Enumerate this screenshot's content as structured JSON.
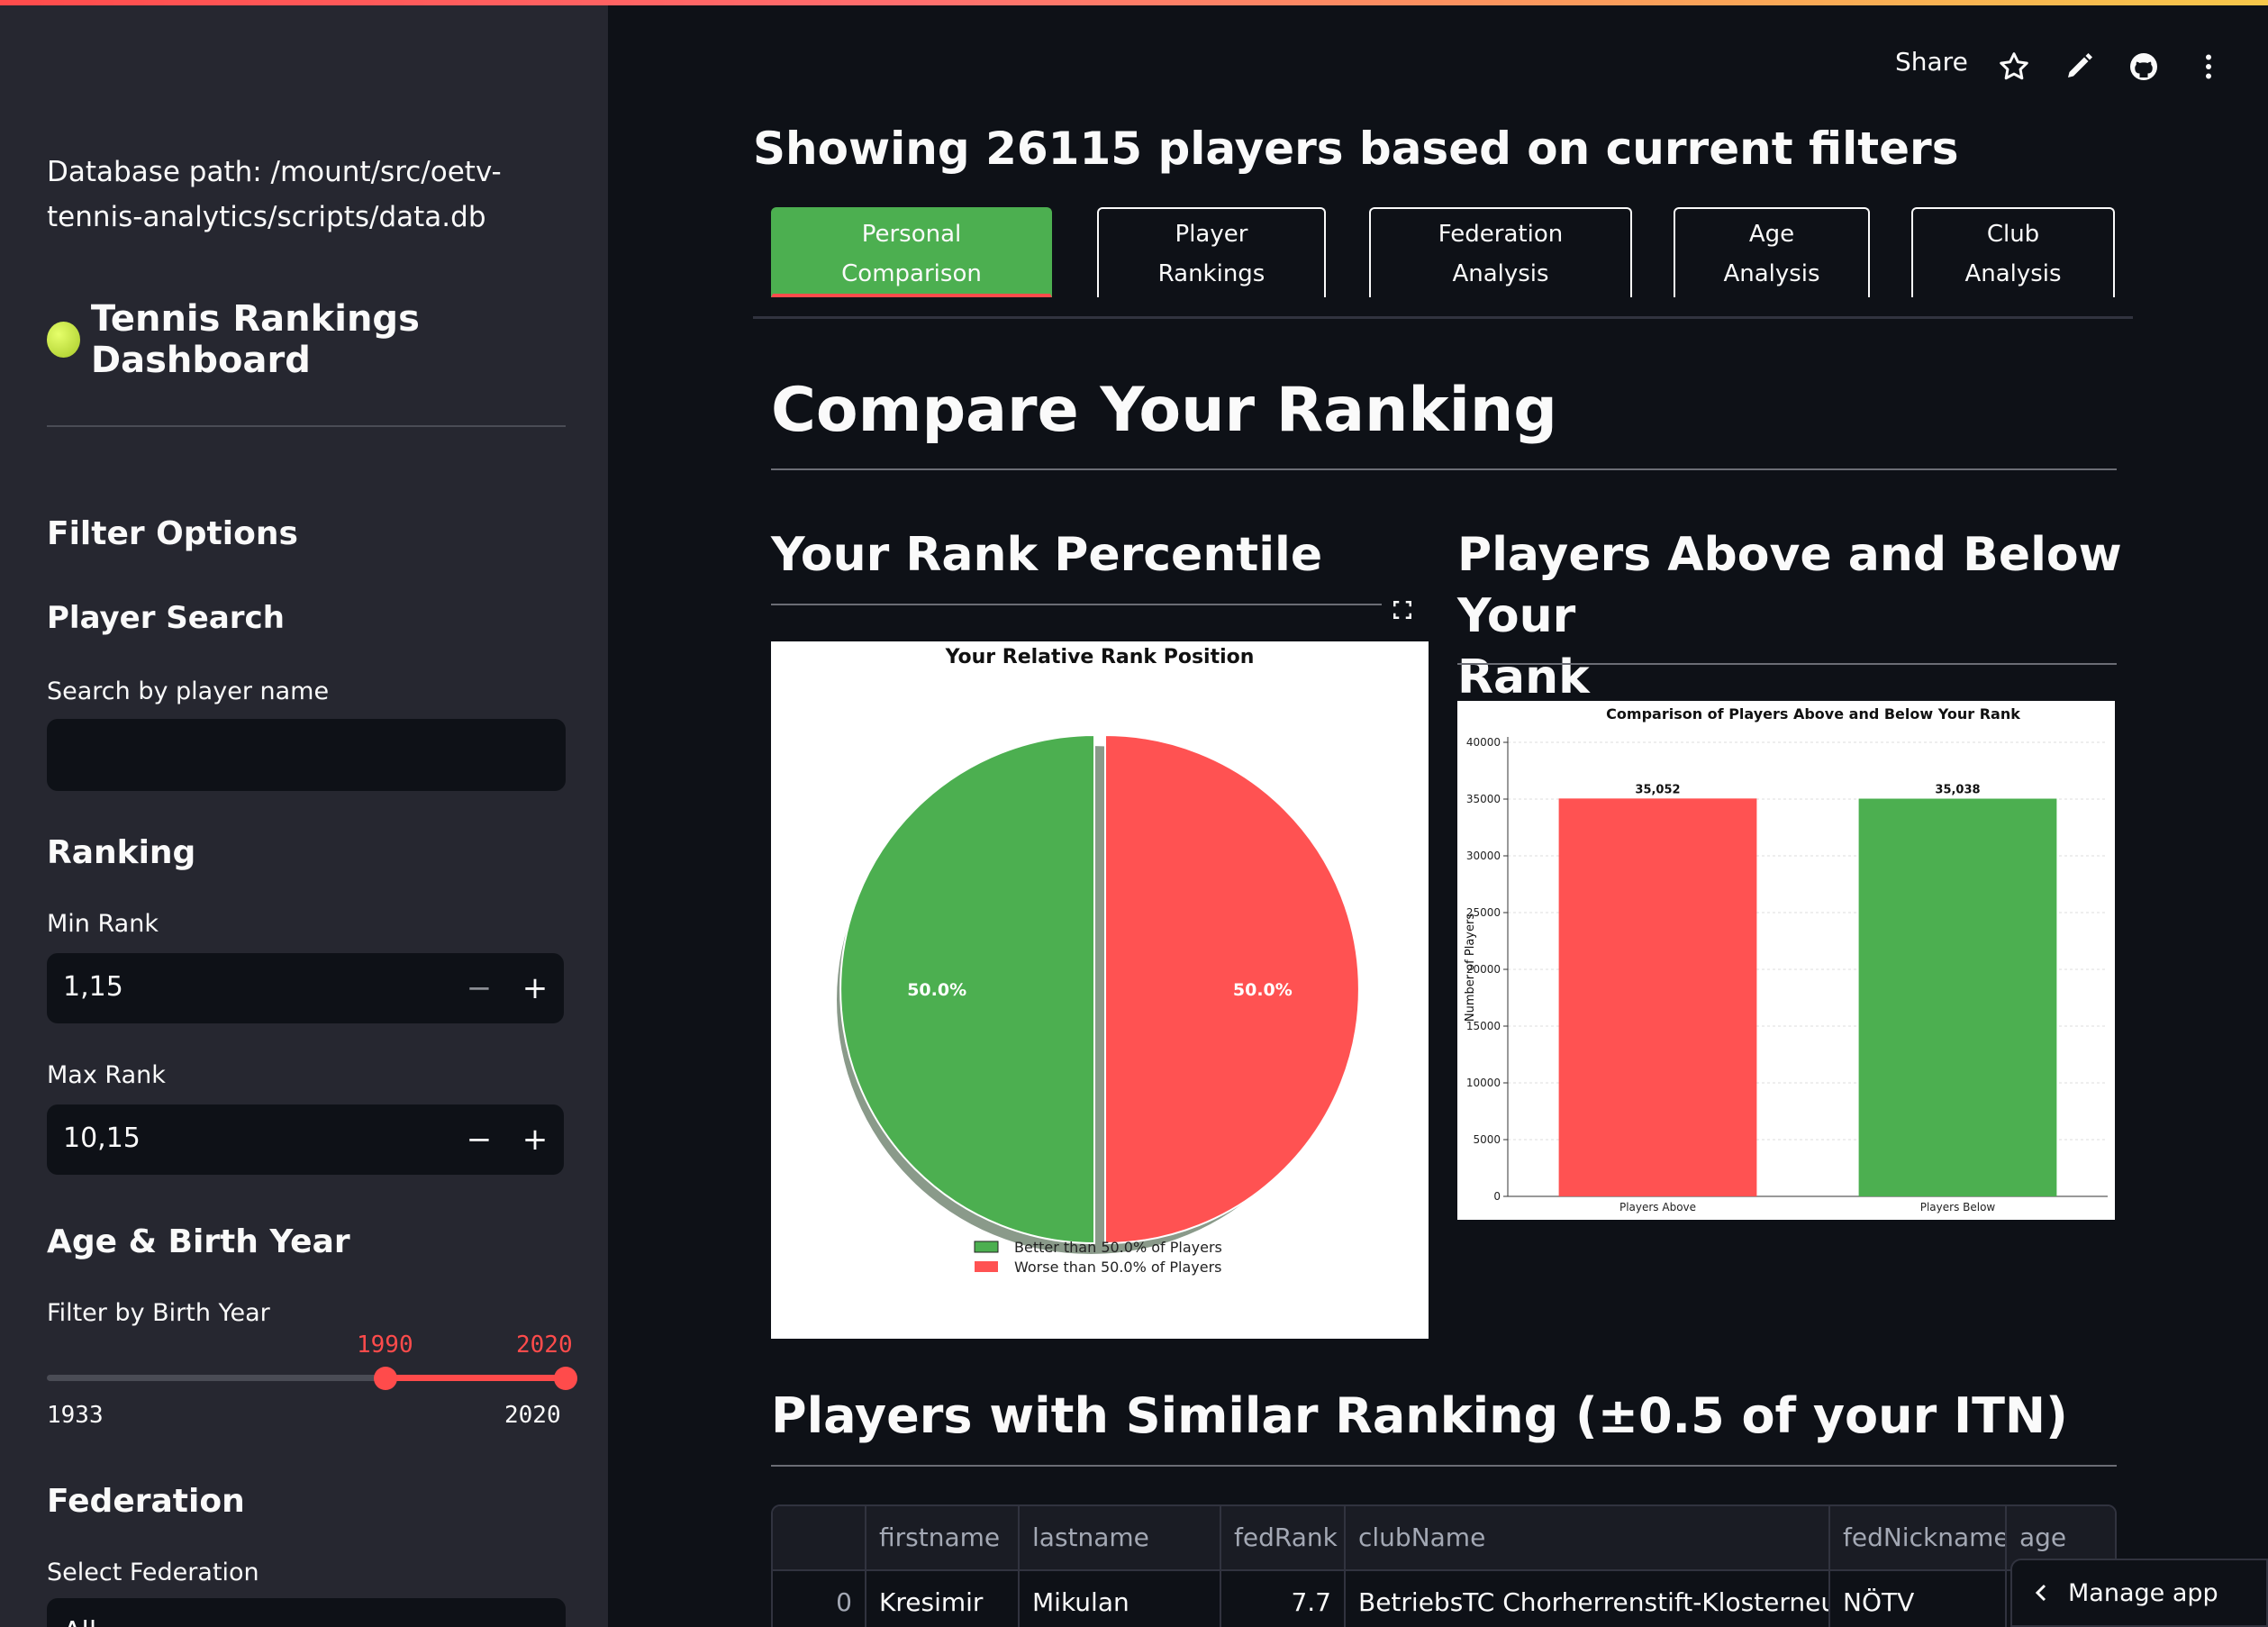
{
  "sidebar": {
    "db_path": "Database path: /mount/src/oetv-tennis-analytics/scripts/data.db",
    "title": "Tennis Rankings Dashboard",
    "filter_options": "Filter Options",
    "player_search": {
      "heading": "Player Search",
      "label": "Search by player name",
      "value": ""
    },
    "ranking": {
      "heading": "Ranking",
      "min_label": "Min Rank",
      "min_value": "1,15",
      "max_label": "Max Rank",
      "max_value": "10,15",
      "minus": "−",
      "plus": "+"
    },
    "age": {
      "heading": "Age & Birth Year",
      "label": "Filter by Birth Year",
      "selected_low": "1990",
      "selected_high": "2020",
      "range_min": "1933",
      "range_max": "2020"
    },
    "federation": {
      "heading": "Federation",
      "label": "Select Federation",
      "value": "All"
    }
  },
  "header": {
    "share": "Share",
    "icons": [
      "star-icon",
      "pencil-icon",
      "github-icon",
      "more-vertical-icon"
    ]
  },
  "main": {
    "title": "Showing 26115 players based on current filters",
    "tabs": [
      {
        "line1": "Personal",
        "line2": "Comparison",
        "active": true
      },
      {
        "line1": "Player",
        "line2": "Rankings",
        "active": false
      },
      {
        "line1": "Federation",
        "line2": "Analysis",
        "active": false
      },
      {
        "line1": "Age",
        "line2": "Analysis",
        "active": false
      },
      {
        "line1": "Club",
        "line2": "Analysis",
        "active": false
      }
    ],
    "section_title": "Compare Your Ranking",
    "left_heading": "Your Rank Percentile",
    "right_heading_line1": "Players Above and Below Your",
    "right_heading_line2": "Rank",
    "similar_heading": "Players with Similar Ranking (±0.5 of your ITN)"
  },
  "chart_data": [
    {
      "type": "pie",
      "title": "Your Relative Rank Position",
      "slices": [
        {
          "label": "Better than 50.0% of Players",
          "value": 50.0,
          "pct_label": "50.0%",
          "color": "#4caf50"
        },
        {
          "label": "Worse than 50.0% of Players",
          "value": 50.0,
          "pct_label": "50.0%",
          "color": "#ff5252"
        }
      ]
    },
    {
      "type": "bar",
      "title": "Comparison of Players Above and Below Your Rank",
      "categories": [
        "Players Above",
        "Players Below"
      ],
      "values": [
        35052,
        35038
      ],
      "value_labels": [
        "35,052",
        "35,038"
      ],
      "colors": [
        "#ff5252",
        "#4caf50"
      ],
      "ylabel": "Number of Players",
      "ylim": [
        0,
        40000
      ],
      "yticks": [
        0,
        5000,
        10000,
        15000,
        20000,
        25000,
        30000,
        35000,
        40000
      ],
      "grid": true
    }
  ],
  "table": {
    "columns": [
      "",
      "firstname",
      "lastname",
      "fedRank",
      "clubName",
      "fedNickname",
      "age"
    ],
    "rows": [
      [
        "0",
        "Kresimir",
        "Mikulan",
        "7.7",
        "BetriebsTC Chorherrenstift-Klosterneuburg",
        "NÖTV",
        ""
      ]
    ]
  },
  "manage_app": "Manage app"
}
